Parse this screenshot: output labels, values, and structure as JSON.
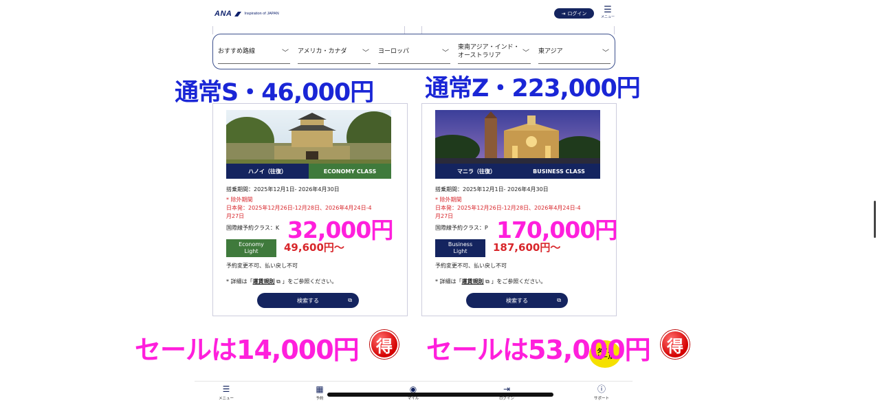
{
  "header": {
    "brand": "ANA",
    "tagline": "Inspiration of JAPAN",
    "login_label": "ログイン",
    "menu_label": "メニュー"
  },
  "regions": [
    {
      "label": "おすすめ路線"
    },
    {
      "label": "アメリカ・カナダ"
    },
    {
      "label": "ヨーロッパ"
    },
    {
      "label": "東南アジア・インド・オーストラリア"
    },
    {
      "label": "東アジア"
    }
  ],
  "annotations": {
    "left_regular": "通常S・46,000円",
    "right_regular": "通常Z・223,000円",
    "left_diff": "32,000円",
    "right_diff": "170,000円",
    "left_sale": "セールは14,000円",
    "right_sale": "セールは53,000円",
    "toku": "得"
  },
  "cards": [
    {
      "city": "ハノイ（往復）",
      "cabin": "ECONOMY CLASS",
      "cabin_color": "#3f7a3c",
      "period": "搭乗期間：2025年12月1日- 2026年4月30日",
      "excl_title": "* 除外期間",
      "excl_line1": "日本発：2025年12月26日-12月28日、2026年4月24日-4",
      "excl_line2": "月27日",
      "booking_class": "国際線予約クラス：K",
      "fare_label_1": "Economy",
      "fare_label_2": "Light",
      "fare_color": "#3f7a3c",
      "price": "49,600円〜",
      "conditions": "予約変更不可、払い戻し不可",
      "detail_pre": "* 詳細は「",
      "detail_link": "運賃規則",
      "detail_post": "」をご参照ください。",
      "search_label": "検索する"
    },
    {
      "city": "マニラ（往復）",
      "cabin": "BUSINESS CLASS",
      "cabin_color": "#14245f",
      "period": "搭乗期間：2025年12月1日- 2026年4月30日",
      "excl_title": "* 除外期間",
      "excl_line1": "日本発：2025年12月26日-12月28日、2026年4月24日-4",
      "excl_line2": "月27日",
      "booking_class": "国際線予約クラス：P",
      "fare_label_1": "Business",
      "fare_label_2": "Light",
      "fare_color": "#14245f",
      "price": "187,600円〜",
      "conditions": "予約変更不可、払い戻し不可",
      "detail_pre": "* 詳細は「",
      "detail_link": "運賃規則",
      "detail_post": "」をご参照ください。",
      "search_label": "検索する"
    }
  ],
  "sale_sticker": {
    "line1": "タイム",
    "line2": "セール"
  },
  "bottom_nav": [
    {
      "label": "メニュー",
      "icon": "menu-icon"
    },
    {
      "label": "予約",
      "icon": "calendar-icon"
    },
    {
      "label": "マイル",
      "icon": "miles-icon"
    },
    {
      "label": "ログイン",
      "icon": "login-icon"
    },
    {
      "label": "サポート",
      "icon": "help-icon"
    }
  ]
}
